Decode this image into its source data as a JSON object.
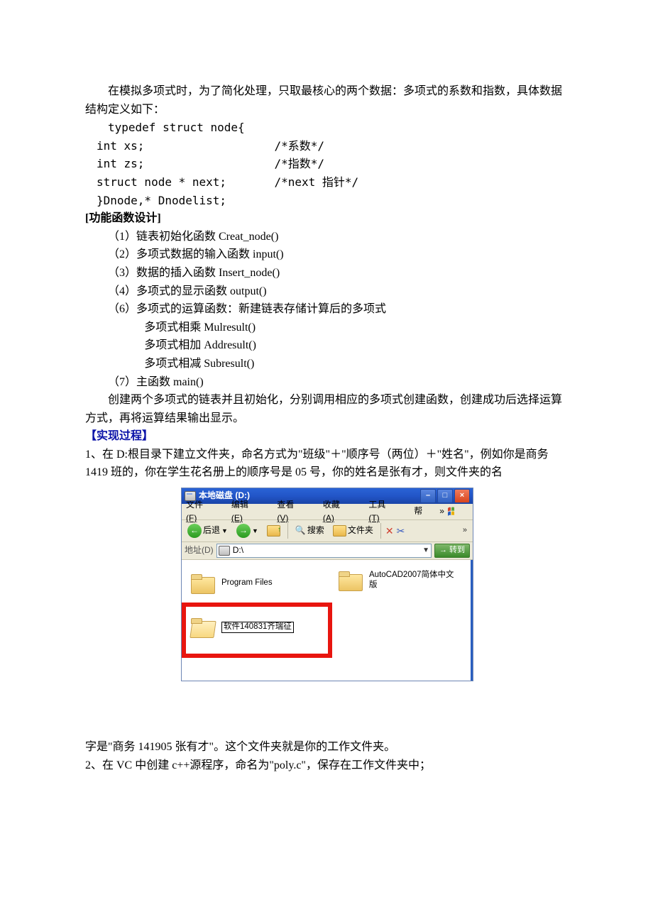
{
  "text": {
    "intro_1": "在模拟多项式时，为了简化处理，只取最核心的两个数据：多项式的系数和指数，具体数据结构定义如下：",
    "code_1": "typedef struct node{",
    "code_2_a": "int xs;",
    "code_2_c": "/*系数*/",
    "code_3_a": "int zs;",
    "code_3_c": "/*指数*/",
    "code_4_a": "struct node * next;",
    "code_4_c": "/*next 指针*/",
    "code_5": "}Dnode,* Dnodelist;",
    "func_heading": "[功能函数设计]",
    "func_1": "（1）链表初始化函数 Creat_node()",
    "func_2": "（2）多项式数据的输入函数 input()",
    "func_3": "（3）数据的插入函数 Insert_node()",
    "func_4": "（4）多项式的显示函数 output()",
    "func_5": "（6）多项式的运算函数：新建链表存储计算后的多项式",
    "func_5a": "多项式相乘 Mulresult()",
    "func_5b": "多项式相加 Addresult()",
    "func_5c": "多项式相减 Subresult()",
    "func_6": "（7）主函数 main()",
    "summary": "创建两个多项式的链表并且初始化，分别调用相应的多项式创建函数，创建成功后选择运算方式，再将运算结果输出显示。",
    "proc_heading": "【实现过程】",
    "step1": "1、在 D:根目录下建立文件夹，命名方式为\"班级\"＋\"顺序号（两位）＋\"姓名\"，例如你是商务 1419 班的，你在学生花名册上的顺序号是 05 号，你的姓名是张有才，则文件夹的名",
    "step1_cont": "字是\"商务 141905 张有才\"。这个文件夹就是你的工作文件夹。",
    "step2": "2、在 VC 中创建 c++源程序，命名为\"poly.c\"，保存在工作文件夹中；"
  },
  "explorer": {
    "title": "本地磁盘 (D:)",
    "menu": {
      "file_label": "文件",
      "file_key": "(F)",
      "edit_label": "编辑",
      "edit_key": "(E)",
      "view_label": "查看",
      "view_key": "(V)",
      "fav_label": "收藏",
      "fav_key": "(A)",
      "tools_label": "工具",
      "tools_key": "(T)",
      "help_label": "帮",
      "more": "»"
    },
    "toolbar": {
      "back": "后退",
      "search": "搜索",
      "folders": "文件夹",
      "more": "»"
    },
    "address": {
      "label": "地址",
      "label_key": "(D)",
      "value": "D:\\",
      "go": "转到"
    },
    "items": {
      "program_files": "Program Files",
      "autocad": "AutoCAD2007简体中文版",
      "new_folder": "软件140831齐瑞征"
    }
  }
}
